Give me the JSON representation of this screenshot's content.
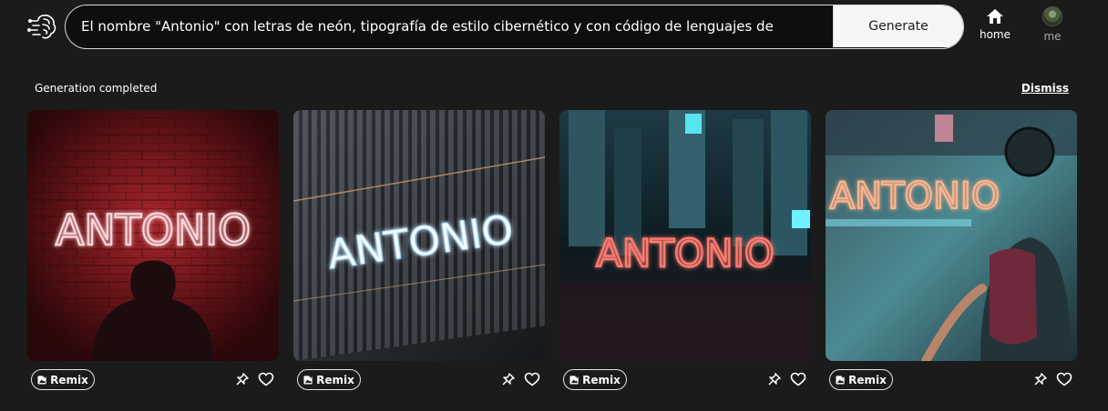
{
  "header": {
    "logo_icon": "brain-icon",
    "prompt_value": "El nombre \"Antonio\" con letras de neón, tipografía de estilo cibernético y con código de lenguajes de",
    "generate_label": "Generate",
    "home_label": "home",
    "me_label": "me"
  },
  "status": {
    "message": "Generation completed",
    "dismiss_label": "Dismiss"
  },
  "cards": [
    {
      "image_text": "ANTONIO",
      "remix_label": "Remix",
      "remix_icon": "image-plus-icon",
      "pin_icon": "pin-icon",
      "favorite_icon": "heart-icon"
    },
    {
      "image_text": "ANTONIO",
      "remix_label": "Remix",
      "remix_icon": "image-plus-icon",
      "pin_icon": "pin-icon",
      "favorite_icon": "heart-icon"
    },
    {
      "image_text": "ANTONIO",
      "remix_label": "Remix",
      "remix_icon": "image-plus-icon",
      "pin_icon": "pin-icon",
      "favorite_icon": "heart-icon"
    },
    {
      "image_text": "ANTONIO",
      "remix_label": "Remix",
      "remix_icon": "image-plus-icon",
      "pin_icon": "pin-icon",
      "favorite_icon": "heart-icon"
    }
  ],
  "colors": {
    "background": "#1b1b1b",
    "neon_red": "#ff4a5a",
    "neon_white_blue": "#e8f4ff",
    "neon_pink": "#ff6a7a",
    "neon_orange": "#ffb070"
  }
}
